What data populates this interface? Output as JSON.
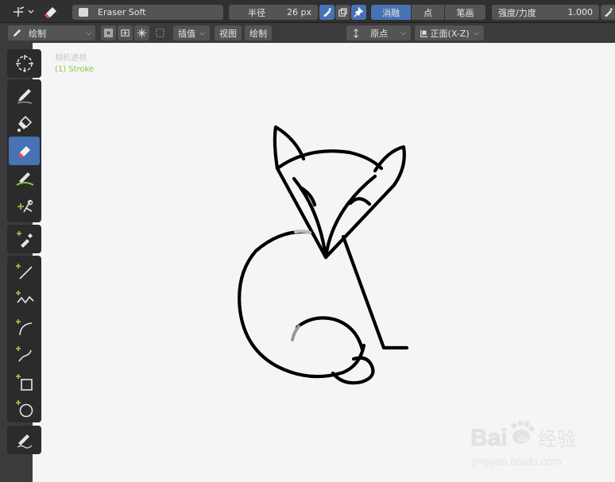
{
  "header": {
    "brush_name": "Eraser Soft",
    "radius_label": "半径",
    "radius_value": "26 px",
    "modes": [
      "消融",
      "点",
      "笔画"
    ],
    "strength_label": "强度/力度",
    "strength_value": "1.000"
  },
  "subheader": {
    "mode_label": "绘制",
    "interp_label": "插值",
    "view_label": "视图",
    "draw_label": "绘制",
    "origin_label": "原点",
    "plane_label": "正面(X-Z)"
  },
  "viewport": {
    "view_name": "相机透视",
    "object_name": "(1) Stroke"
  },
  "toolbar": {
    "tools": [
      "cursor-icon",
      "draw-icon",
      "fill-icon",
      "erase-icon",
      "tint-icon",
      "cutter-icon",
      "eyedropper-icon",
      "line-icon",
      "polyline-icon",
      "arc-icon",
      "curve-icon",
      "box-icon",
      "circle-icon",
      "annotate-icon"
    ]
  },
  "watermark": {
    "brand": "Bai 经验",
    "url": "jingyan.baidu.com"
  },
  "colors": {
    "accent": "#4772b3",
    "header": "#303030",
    "canvas": "#f5f5f5",
    "stroke": "#000000",
    "object_label": "#8ec63f"
  }
}
